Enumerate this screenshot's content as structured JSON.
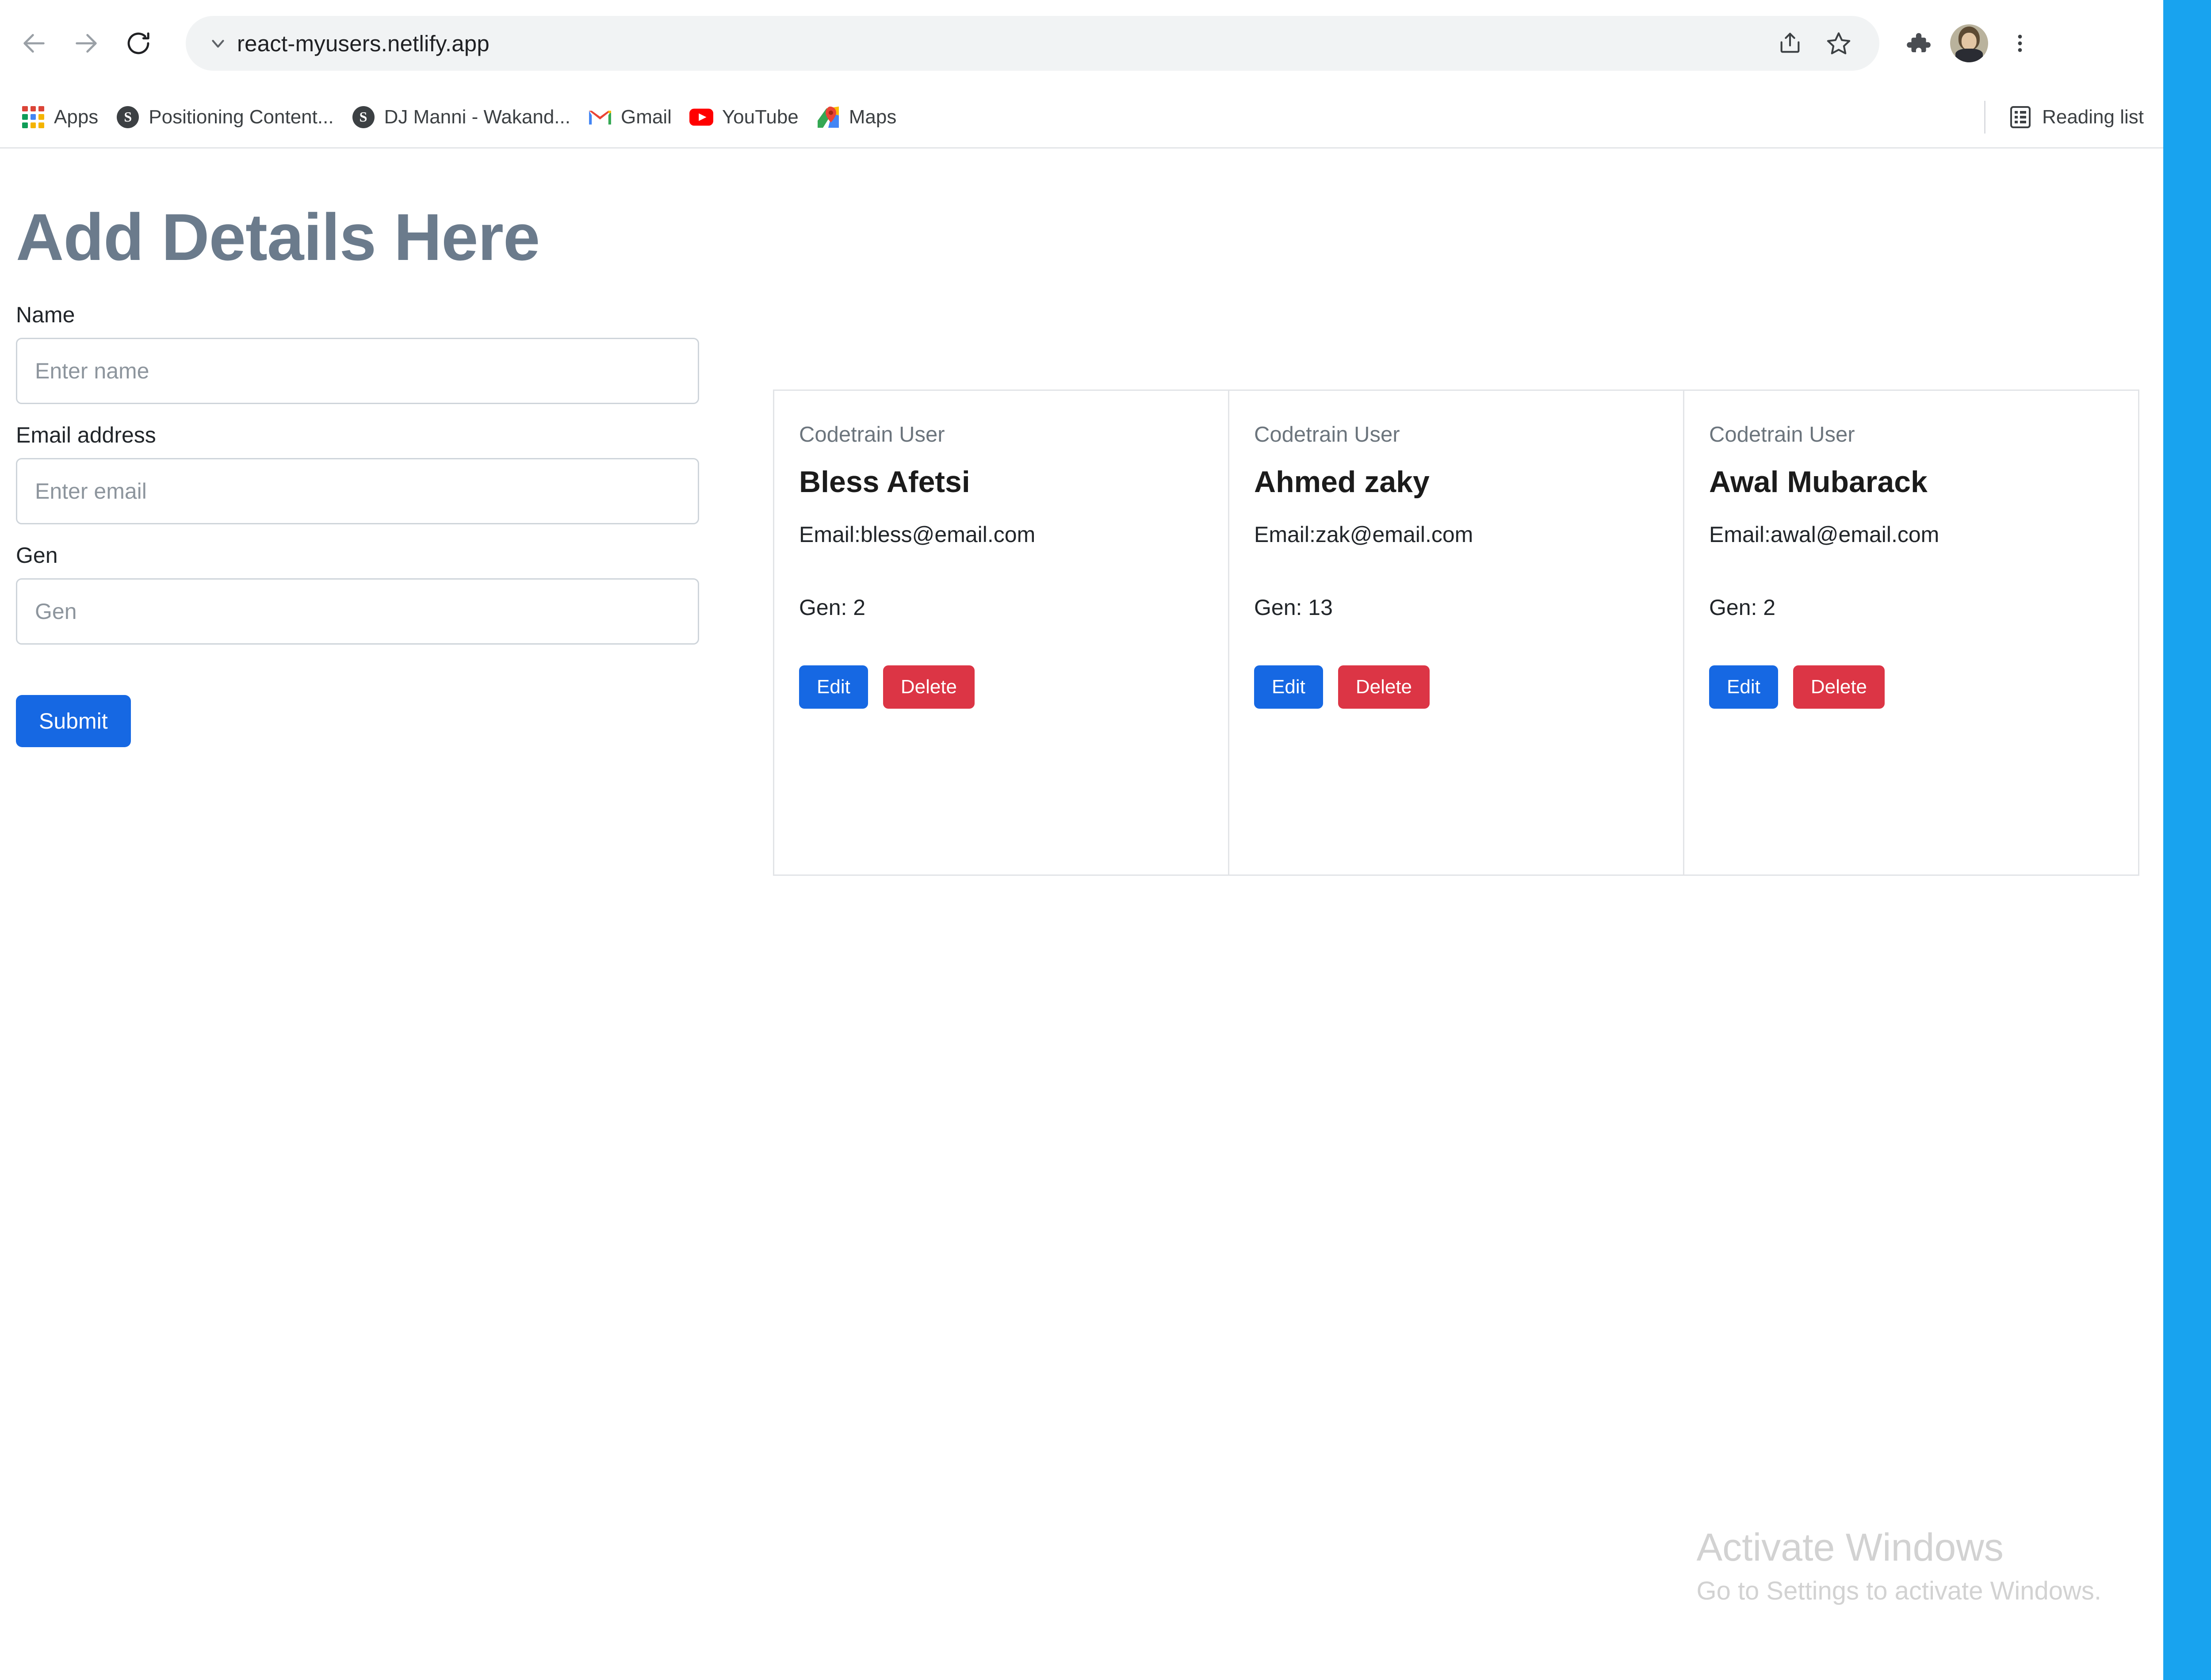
{
  "browser": {
    "nav": {
      "back_label": "Back",
      "forward_label": "Forward",
      "reload_label": "Reload"
    },
    "omnibox": {
      "url": "react-myusers.netlify.app",
      "chevron_label": "View site information",
      "share_label": "Share this page",
      "bookmark_label": "Bookmark this tab"
    },
    "toolbar_tail": {
      "extensions_label": "Extensions",
      "profile_label": "Profile",
      "menu_label": "Customize and control Google Chrome"
    },
    "bookmarks": [
      {
        "label": "Apps",
        "icon": "apps-grid-icon"
      },
      {
        "label": "Positioning Content...",
        "icon": "globe-favicon-icon"
      },
      {
        "label": "DJ Manni - Wakand...",
        "icon": "globe-favicon-icon"
      },
      {
        "label": "Gmail",
        "icon": "gmail-icon"
      },
      {
        "label": "YouTube",
        "icon": "youtube-icon"
      },
      {
        "label": "Maps",
        "icon": "maps-icon"
      }
    ],
    "reading_list": {
      "label": "Reading list",
      "icon": "reading-list-icon"
    }
  },
  "page": {
    "title": "Add Details Here",
    "form": {
      "fields": [
        {
          "label": "Name",
          "placeholder": "Enter name",
          "value": ""
        },
        {
          "label": "Email address",
          "placeholder": "Enter email",
          "value": ""
        },
        {
          "label": "Gen",
          "placeholder": "Gen",
          "value": ""
        }
      ],
      "submit_label": "Submit"
    },
    "cards": [
      {
        "subtitle": "Codetrain User",
        "name": "Bless Afetsi",
        "email": "Email:bless@email.com",
        "gen": "Gen: 2",
        "edit_label": "Edit",
        "delete_label": "Delete"
      },
      {
        "subtitle": "Codetrain User",
        "name": "Ahmed zaky",
        "email": "Email:zak@email.com",
        "gen": "Gen: 13",
        "edit_label": "Edit",
        "delete_label": "Delete"
      },
      {
        "subtitle": "Codetrain User",
        "name": "Awal Mubarack",
        "email": "Email:awal@email.com",
        "gen": "Gen: 2",
        "edit_label": "Edit",
        "delete_label": "Delete"
      }
    ]
  },
  "watermark": {
    "title": "Activate Windows",
    "subtitle": "Go to Settings to activate Windows."
  },
  "colors": {
    "primary_blue": "#1668e3",
    "danger_red": "#dc3545",
    "heading_slate": "#6b7b8c",
    "desktop_blue": "#18A3EF",
    "muted_gray": "#6c757d"
  }
}
